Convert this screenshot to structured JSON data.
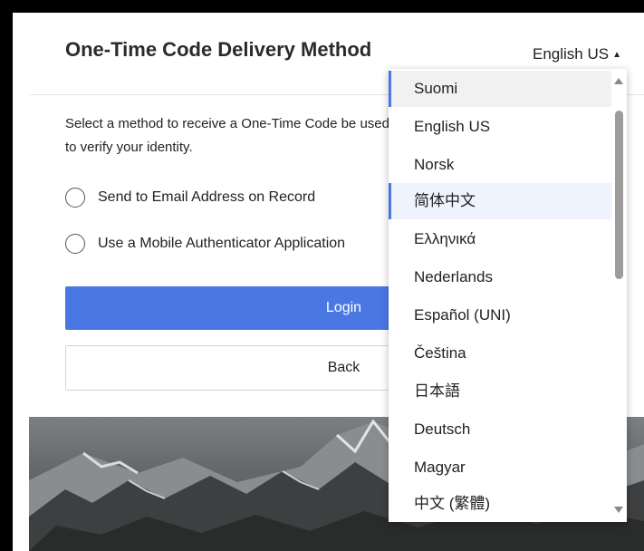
{
  "page": {
    "title": "One-Time Code Delivery Method",
    "instructions": "Select a method to receive a One-Time Code be used to verify your identity."
  },
  "language": {
    "current": "English US",
    "options": [
      "Suomi",
      "English US",
      "Norsk",
      "简体中文",
      "Ελληνικά",
      "Nederlands",
      "Español (UNI)",
      "Čeština",
      "日本語",
      "Deutsch",
      "Magyar",
      "中文 (繁體)"
    ],
    "highlighted": "Suomi",
    "selected": "简体中文"
  },
  "methods": [
    {
      "label": "Send to Email Address on Record",
      "checked": false
    },
    {
      "label": "Use a Mobile Authenticator Application",
      "checked": false
    }
  ],
  "buttons": {
    "login": "Login",
    "back": "Back"
  },
  "colors": {
    "primary": "#4a78e3",
    "frame": "#000000"
  }
}
